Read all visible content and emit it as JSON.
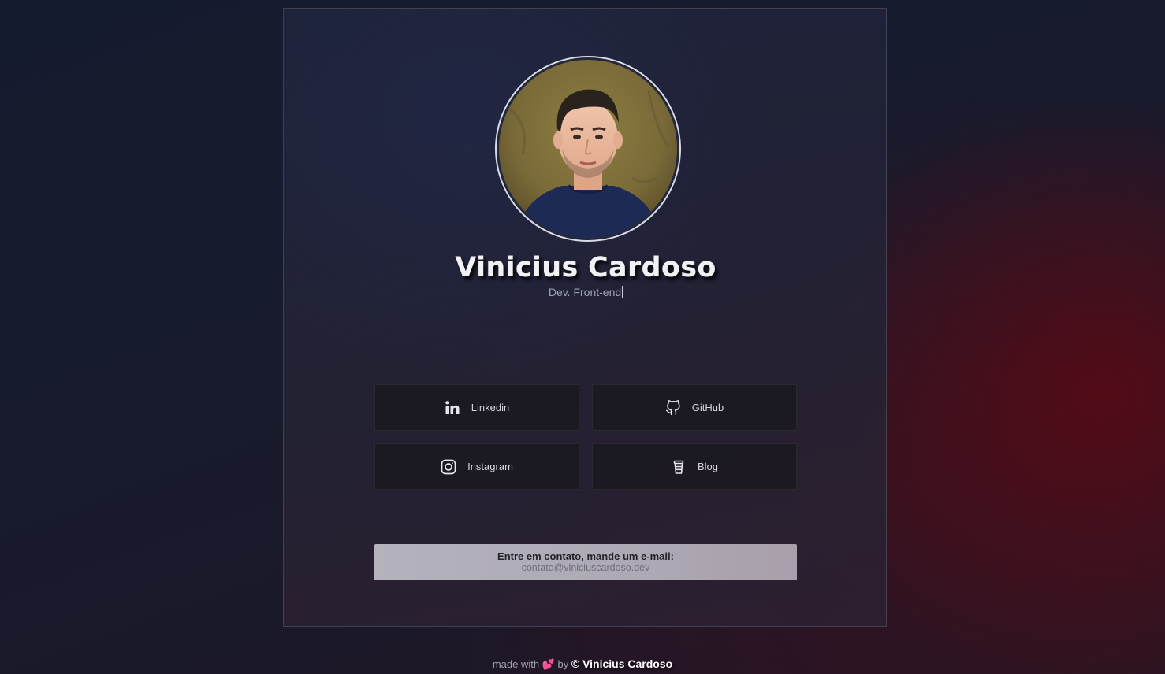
{
  "profile": {
    "name": "Vinicius Cardoso",
    "role": "Dev. Front-end"
  },
  "links": [
    {
      "label": "Linkedin",
      "icon": "linkedin-icon"
    },
    {
      "label": "GitHub",
      "icon": "github-icon"
    },
    {
      "label": "Instagram",
      "icon": "instagram-icon"
    },
    {
      "label": "Blog",
      "icon": "coffee-cup-icon"
    }
  ],
  "contact": {
    "title": "Entre em contato, mande um e-mail:",
    "email": "contato@viniciuscardoso.dev"
  },
  "footer": {
    "made_with": "made with",
    "heart": "💕",
    "by": "by",
    "author": "© Vinicius Cardoso"
  },
  "colors": {
    "card_border": "#3a3d50",
    "button_bg": "#1d1b24",
    "contact_bg": "#b0adb8",
    "heart": "#e4508d"
  }
}
